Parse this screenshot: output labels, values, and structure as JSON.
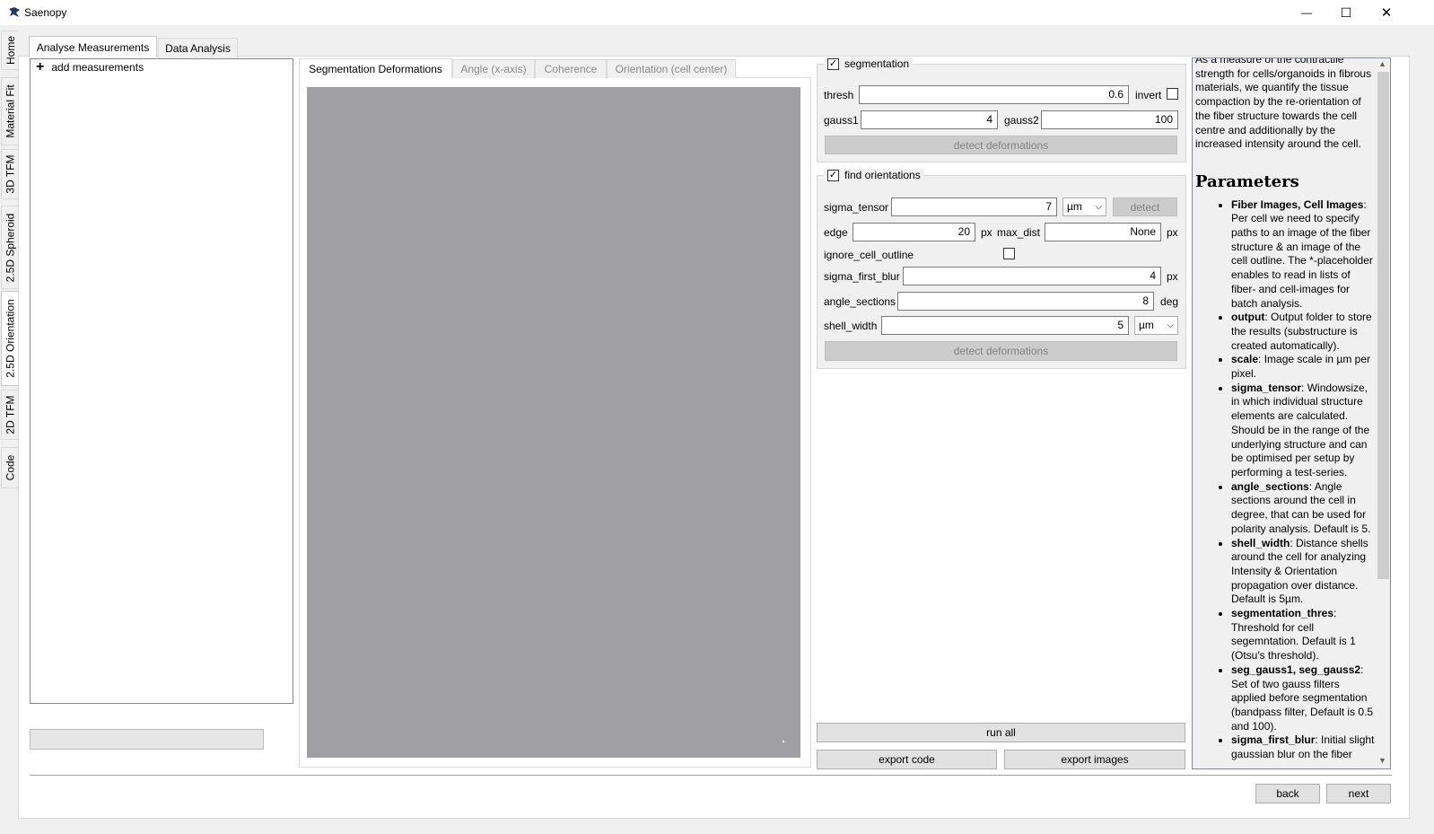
{
  "window": {
    "title": "Saenopy",
    "minimize_glyph": "—",
    "maximize_glyph": "☐",
    "close_glyph": "✕"
  },
  "side_tabs": [
    {
      "label": "Home"
    },
    {
      "label": "Material Fit"
    },
    {
      "label": "3D TFM"
    },
    {
      "label": "2.5D Spheroid"
    },
    {
      "label": "2.5D Orientation",
      "active": true
    },
    {
      "label": "2D TFM"
    },
    {
      "label": "Code"
    }
  ],
  "top_tabs": {
    "analyse": "Analyse Measurements",
    "data": "Data Analysis"
  },
  "tree": {
    "add_measurements": "add measurements"
  },
  "image_tabs": {
    "seg": "Segmentation Deformations",
    "angle": "Angle (x-axis)",
    "coherence": "Coherence",
    "orientation": "Orientation (cell center)"
  },
  "segmentation": {
    "title": "segmentation",
    "checked": true,
    "thresh_label": "thresh",
    "thresh_value": "0.6",
    "invert_label": "invert",
    "gauss1_label": "gauss1",
    "gauss1_value": "4",
    "gauss2_label": "gauss2",
    "gauss2_value": "100",
    "detect_button": "detect deformations"
  },
  "orientations": {
    "title": "find orientations",
    "checked": true,
    "sigma_tensor_label": "sigma_tensor",
    "sigma_tensor_value": "7",
    "sigma_tensor_unit": "µm",
    "detect_button_small": "detect",
    "edge_label": "edge",
    "edge_value": "20",
    "px": "px",
    "max_dist_label": "max_dist",
    "max_dist_value": "None",
    "ignore_label": "ignore_cell_outline",
    "sigma_first_blur_label": "sigma_first_blur",
    "sigma_first_blur_value": "4",
    "angle_sections_label": "angle_sections",
    "angle_sections_value": "8",
    "deg": "deg",
    "shell_width_label": "shell_width",
    "shell_width_value": "5",
    "shell_width_unit": "µm",
    "detect_button": "detect deformations"
  },
  "actions": {
    "run_all": "run all",
    "export_code": "export code",
    "export_images": "export images",
    "back": "back",
    "next": "next"
  },
  "help": {
    "intro": "As a measure of the contractile strength for cells/organoids in fibrous materials, we quantify the tissue compaction by the re-orientation of the fiber structure towards the cell centre and additionally by the increased intensity around the cell.",
    "heading": "Parameters",
    "items": [
      {
        "term": "Fiber Images, Cell Images",
        "text": ": Per cell we need to specify paths to an image of the fiber structure & an image of the cell outline. The *-placeholder enables to read in lists of fiber- and cell-images for batch analysis."
      },
      {
        "term": "output",
        "text": ": Output folder to store the results (substructure is created automatically)."
      },
      {
        "term": "scale",
        "text": ": Image scale in µm per pixel."
      },
      {
        "term": "sigma_tensor",
        "text": ": Windowsize, in which individual structure elements are calculated. Should be in the range of the underlying structure and can be optimised per setup by performing a test-series."
      },
      {
        "term": "angle_sections",
        "text": ": Angle sections around the cell in degree, that can be used for polarity analysis. Default is 5."
      },
      {
        "term": "shell_width",
        "text": ": Distance shells around the cell for analyzing Intensity & Orientation propagation over distance. Default is 5µm."
      },
      {
        "term": "segmentation_thres",
        "text": ": Threshold for cell segemntation. Default is 1 (Otsu's threshold)."
      },
      {
        "term": "seg_gauss1, seg_gauss2",
        "text": ": Set of two gauss filters applied before segmentation (bandpass filter, Default is 0.5 and 100)."
      },
      {
        "term": "sigma_first_blur",
        "text": ": Initial slight gaussian blur on the fiber"
      }
    ],
    "scroll_up": "▲",
    "scroll_down": "▼"
  }
}
